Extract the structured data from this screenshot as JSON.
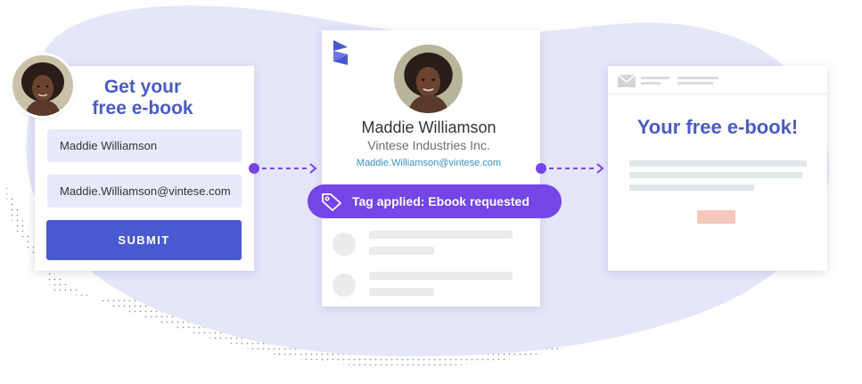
{
  "form": {
    "title_line1": "Get your",
    "title_line2": "free e-book",
    "name_value": "Maddie Williamson",
    "email_value": "Maddie.Williamson@vintese.com",
    "submit_label": "SUBMIT"
  },
  "contact": {
    "name": "Maddie Williamson",
    "company": "Vintese Industries Inc.",
    "email": "Maddie.Williamson@vintese.com",
    "tag_label": "Tag applied: Ebook requested"
  },
  "email_preview": {
    "heading": "Your free e-book!"
  },
  "icons": {
    "brand": "brand-logo-icon",
    "tag": "tag-icon",
    "mail": "envelope-icon",
    "arrows": "dashed-arrow-icon"
  },
  "colors": {
    "primary_blue": "#4959cf",
    "heading_blue": "#4a5bc4",
    "tag_purple": "#7545e6",
    "field_bg": "#e8e9fb",
    "link_blue": "#3a8fbd",
    "cta_peach": "#f6c8bd",
    "blob_lavender": "#e6e6fa"
  }
}
